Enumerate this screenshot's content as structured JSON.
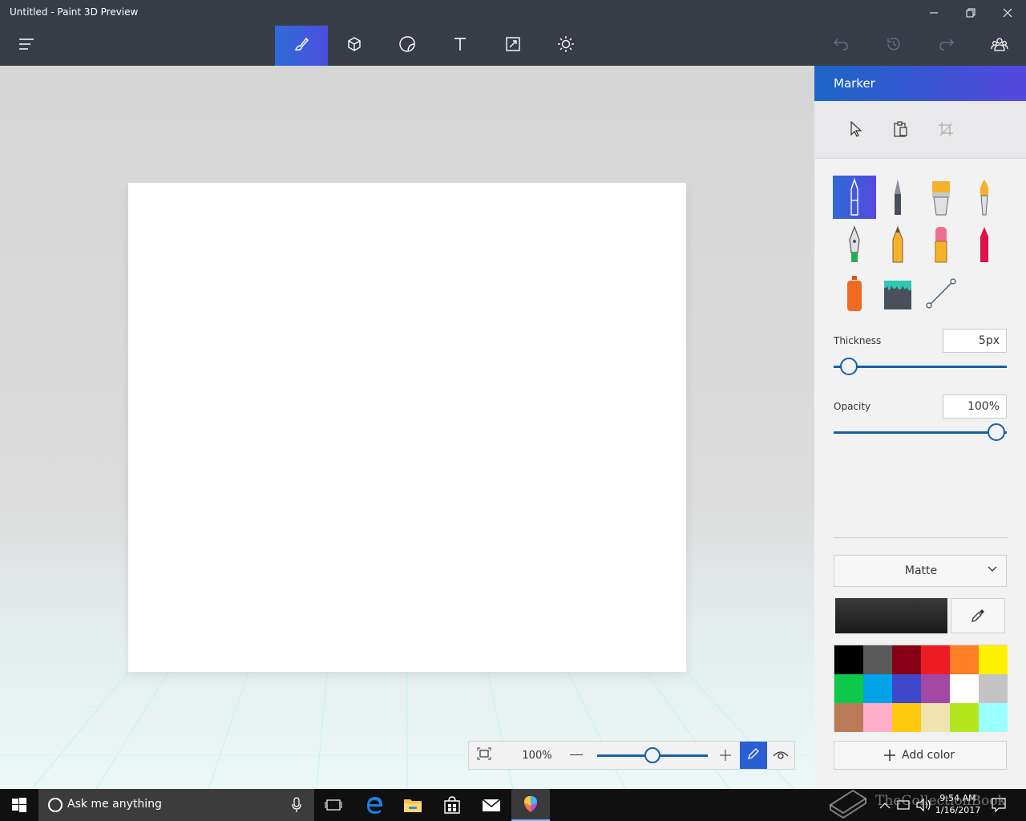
{
  "window": {
    "title": "Untitled - Paint 3D Preview"
  },
  "toolbar": {
    "tools": [
      "art-tools",
      "3d-objects",
      "stickers",
      "text",
      "canvas",
      "effects"
    ],
    "active_tool": "art-tools"
  },
  "zoom": {
    "value": "100%",
    "level_percent": 100,
    "slider_fraction": 0.5
  },
  "panel": {
    "title": "Marker",
    "brushes": [
      "marker",
      "calligraphy-pen",
      "oil-brush",
      "watercolor",
      "pixel-pen",
      "pencil",
      "eraser",
      "crayon",
      "spray-can",
      "fill",
      "line"
    ],
    "active_brush": "marker",
    "thickness": {
      "label": "Thickness",
      "value": "5px",
      "slider_fraction": 0.08
    },
    "opacity": {
      "label": "Opacity",
      "value": "100%",
      "slider_fraction": 1.0
    },
    "finish": {
      "value": "Matte"
    },
    "current_color": "#1a1a1a",
    "palette": [
      "#000000",
      "#595959",
      "#880015",
      "#ed1c24",
      "#ff7f27",
      "#fff200",
      "#0ec84a",
      "#00a2e8",
      "#3f48cc",
      "#a349a4",
      "#ffffff",
      "#c3c3c3",
      "#b97a57",
      "#ffaec9",
      "#ffc90e",
      "#efe4b0",
      "#b5e61d",
      "#99ffff"
    ],
    "add_color_label": "Add color"
  },
  "taskbar": {
    "search_placeholder": "Ask me anything",
    "time": "9:54 AM",
    "date": "1/16/2017"
  },
  "watermark": {
    "text": "TheCollectionBook"
  }
}
